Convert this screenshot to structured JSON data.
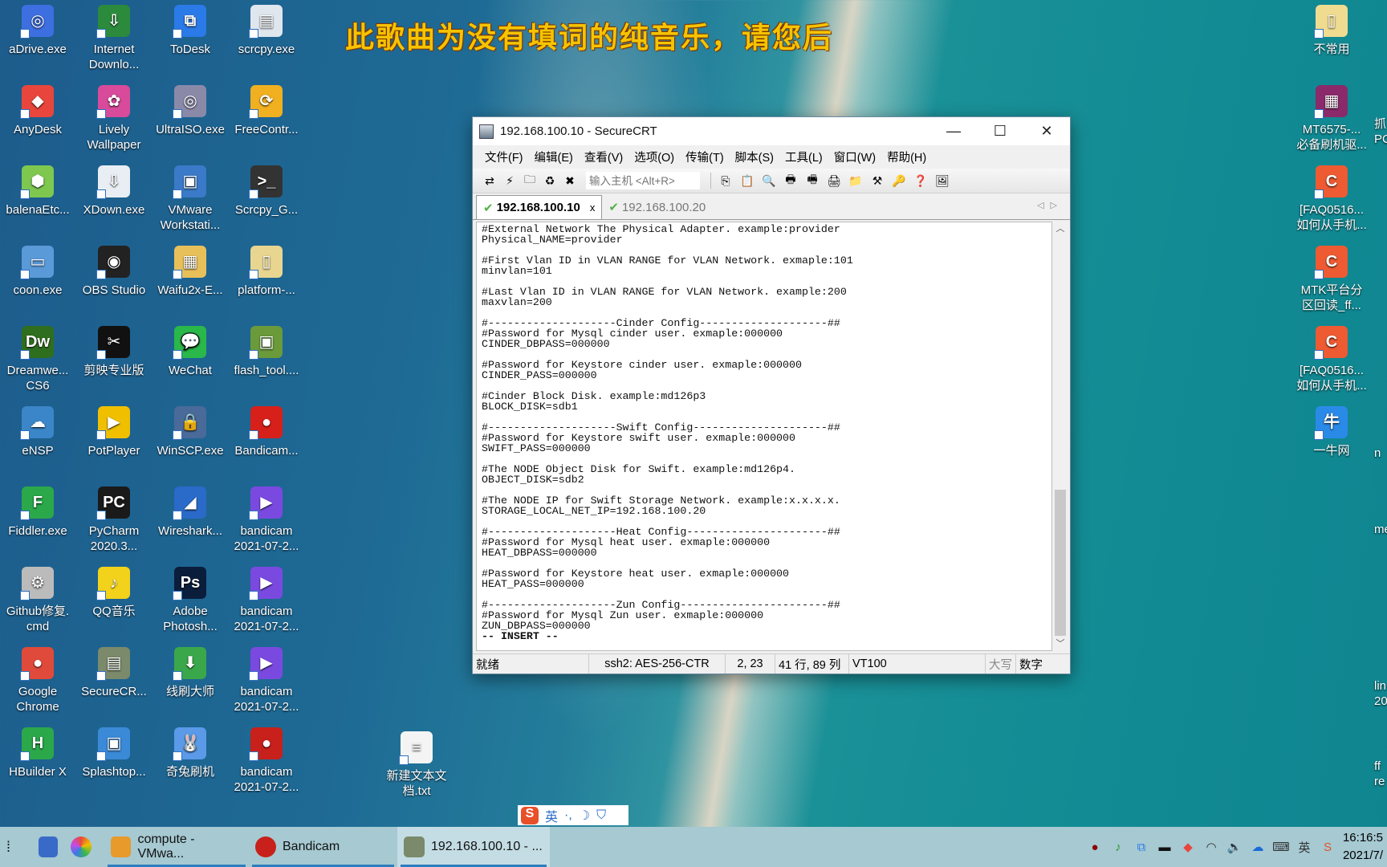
{
  "lyrics": "此歌曲为没有填词的纯音乐，请您后",
  "desktop_icons": [
    {
      "label": "aDrive.exe",
      "color": "#3d6fe0",
      "glyph": "◎"
    },
    {
      "label": "AnyDesk",
      "color": "#e8463c",
      "glyph": "◆"
    },
    {
      "label": "balenaEtc...",
      "color": "#7ec850",
      "glyph": "⬢"
    },
    {
      "label": "coon.exe",
      "color": "#5a9ad8",
      "glyph": "▭"
    },
    {
      "label": "Dreamwe...\nCS6",
      "color": "#2f6e1e",
      "glyph": "Dw"
    },
    {
      "label": "eNSP",
      "color": "#3a86c8",
      "glyph": "☁"
    },
    {
      "label": "Fiddler.exe",
      "color": "#2aa84a",
      "glyph": "F"
    },
    {
      "label": "Github修复.\ncmd",
      "color": "#bbbbbb",
      "glyph": "⚙"
    },
    {
      "label": "Google\nChrome",
      "color": "#e04a3a",
      "glyph": "●"
    },
    {
      "label": "HBuilder X",
      "color": "#2aa84a",
      "glyph": "H"
    },
    {
      "label": "Internet\nDownlo...",
      "color": "#2b8a3c",
      "glyph": "⇩"
    },
    {
      "label": "Lively\nWallpaper",
      "color": "#d84a9a",
      "glyph": "✿"
    },
    {
      "label": "XDown.exe",
      "color": "#e8eef4",
      "glyph": "⇩"
    },
    {
      "label": "OBS Studio",
      "color": "#222222",
      "glyph": "◉"
    },
    {
      "label": "剪映专业版",
      "color": "#111111",
      "glyph": "✂"
    },
    {
      "label": "PotPlayer",
      "color": "#f0c000",
      "glyph": "▶"
    },
    {
      "label": "PyCharm\n2020.3...",
      "color": "#1a1a1a",
      "glyph": "PC"
    },
    {
      "label": "QQ音乐",
      "color": "#f2d21a",
      "glyph": "♪"
    },
    {
      "label": "SecureCR...",
      "color": "#7a8a6a",
      "glyph": "▤"
    },
    {
      "label": "Splashtop...",
      "color": "#3a8ad8",
      "glyph": "▣"
    },
    {
      "label": "ToDesk",
      "color": "#2a7ae8",
      "glyph": "⧉"
    },
    {
      "label": "UltraISO.exe",
      "color": "#8a8aa8",
      "glyph": "◎"
    },
    {
      "label": "VMware\nWorkstati...",
      "color": "#3a7ac8",
      "glyph": "▣"
    },
    {
      "label": "Waifu2x-E...",
      "color": "#e8c05a",
      "glyph": "▦"
    },
    {
      "label": "WeChat",
      "color": "#2ab84a",
      "glyph": "💬"
    },
    {
      "label": "WinSCP.exe",
      "color": "#4a6a9a",
      "glyph": "🔒"
    },
    {
      "label": "Wireshark...",
      "color": "#2a6ac8",
      "glyph": "◢"
    },
    {
      "label": "Adobe\nPhotosh...",
      "color": "#0a1e3c",
      "glyph": "Ps"
    },
    {
      "label": "线刷大师",
      "color": "#3aa84a",
      "glyph": "⬇"
    },
    {
      "label": "奇兔刷机",
      "color": "#5a9ae8",
      "glyph": "🐰"
    },
    {
      "label": "scrcpy.exe",
      "color": "#dfe6ee",
      "glyph": "▤"
    },
    {
      "label": "FreeContr...",
      "color": "#f0b020",
      "glyph": "⟳"
    },
    {
      "label": "Scrcpy_G...",
      "color": "#333333",
      "glyph": ">_"
    },
    {
      "label": "platform-...",
      "color": "#e8d690",
      "glyph": "▯"
    },
    {
      "label": "flash_tool....",
      "color": "#6a9a3a",
      "glyph": "▣"
    },
    {
      "label": "Bandicam...",
      "color": "#d8201a",
      "glyph": "●"
    },
    {
      "label": "bandicam\n2021-07-2...",
      "color": "#7a4ae0",
      "glyph": "▶"
    },
    {
      "label": "bandicam\n2021-07-2...",
      "color": "#7a4ae0",
      "glyph": "▶"
    },
    {
      "label": "bandicam\n2021-07-2...",
      "color": "#7a4ae0",
      "glyph": "▶"
    },
    {
      "label": "bandicam\n2021-07-2...",
      "color": "#c8201a",
      "glyph": "●"
    },
    {
      "label": "新建文本文\n档.txt",
      "color": "#f4f4f4",
      "glyph": "≡"
    },
    {
      "label": "不常用",
      "color": "#f0dc90",
      "glyph": "▯"
    },
    {
      "label": "MT6575-...\n必备刷机驱...",
      "color": "#8a2a6a",
      "glyph": "▦"
    },
    {
      "label": "[FAQ0516...\n如何从手机...",
      "color": "#ee5a32",
      "glyph": "C"
    },
    {
      "label": "MTK平台分\n区回读_ff...",
      "color": "#ee5a32",
      "glyph": "C"
    },
    {
      "label": "[FAQ0516...\n如何从手机...",
      "color": "#ee5a32",
      "glyph": "C"
    },
    {
      "label": "一牛网",
      "color": "#2a8ae8",
      "glyph": "牛"
    }
  ],
  "edge_fragments": [
    "抓\nPC",
    "n",
    "me",
    "lin\n20",
    "ff\nre"
  ],
  "window": {
    "title": "192.168.100.10 - SecureCRT",
    "controls": {
      "minimize": "—",
      "maximize": "☐",
      "close": "✕"
    },
    "menu": [
      "文件(F)",
      "编辑(E)",
      "查看(V)",
      "选项(O)",
      "传输(T)",
      "脚本(S)",
      "工具(L)",
      "窗口(W)",
      "帮助(H)"
    ],
    "toolbar_left": [
      {
        "name": "connect-icon",
        "glyph": "⇄"
      },
      {
        "name": "quick-connect-icon",
        "glyph": "⚡"
      },
      {
        "name": "connect-tab-icon",
        "glyph": "🗀"
      },
      {
        "name": "reconnect-icon",
        "glyph": "♻"
      },
      {
        "name": "disconnect-icon",
        "glyph": "✖"
      }
    ],
    "host_placeholder": "输入主机 <Alt+R>",
    "toolbar_right": [
      {
        "name": "copy-icon",
        "glyph": "⎘"
      },
      {
        "name": "paste-icon",
        "glyph": "📋"
      },
      {
        "name": "find-icon",
        "glyph": "🔍"
      },
      {
        "name": "print-icon",
        "glyph": "🖶"
      },
      {
        "name": "print-selection-icon",
        "glyph": "🖷"
      },
      {
        "name": "print-screen-icon",
        "glyph": "🖨"
      },
      {
        "name": "session-options-icon",
        "glyph": "📁"
      },
      {
        "name": "global-options-icon",
        "glyph": "⚒"
      },
      {
        "name": "keymap-icon",
        "glyph": "🔑"
      },
      {
        "name": "help-icon",
        "glyph": "❓"
      },
      {
        "name": "sftp-icon",
        "glyph": "🖼"
      }
    ],
    "tabs": [
      {
        "label": "192.168.100.10",
        "active": true,
        "close": "x"
      },
      {
        "label": "192.168.100.20",
        "active": false
      }
    ],
    "terminal_lines": [
      "#External Network The Physical Adapter. example:provider",
      "Physical_NAME=provider",
      "",
      "#First Vlan ID in VLAN RANGE for VLAN Network. exmaple:101",
      "minvlan=101",
      "",
      "#Last Vlan ID in VLAN RANGE for VLAN Network. example:200",
      "maxvlan=200",
      "",
      "#--------------------Cinder Config--------------------##",
      "#Password for Mysql cinder user. exmaple:000000",
      "CINDER_DBPASS=000000",
      "",
      "#Password for Keystore cinder user. exmaple:000000",
      "CINDER_PASS=000000",
      "",
      "#Cinder Block Disk. example:md126p3",
      "BLOCK_DISK=sdb1",
      "",
      "#--------------------Swift Config---------------------##",
      "#Password for Keystore swift user. exmaple:000000",
      "SWIFT_PASS=000000",
      "",
      "#The NODE Object Disk for Swift. example:md126p4.",
      "OBJECT_DISK=sdb2",
      "",
      "#The NODE IP for Swift Storage Network. example:x.x.x.x.",
      "STORAGE_LOCAL_NET_IP=192.168.100.20",
      "",
      "#--------------------Heat Config----------------------##",
      "#Password for Mysql heat user. exmaple:000000",
      "HEAT_DBPASS=000000",
      "",
      "#Password for Keystore heat user. exmaple:000000",
      "HEAT_PASS=000000",
      "",
      "#--------------------Zun Config-----------------------##",
      "#Password for Mysql Zun user. exmaple:000000",
      "ZUN_DBPASS=000000",
      ""
    ],
    "mode_line": "-- INSERT --",
    "status": {
      "ready": "就绪",
      "cipher": "ssh2: AES-256-CTR",
      "cursor": "2,  23",
      "size": "41 行, 89 列",
      "emulation": "VT100",
      "caps": "大写",
      "num": "数字"
    }
  },
  "taskbar": {
    "apps": [
      {
        "label": "compute - VMwa...",
        "color": "#e89a2a"
      },
      {
        "label": "Bandicam",
        "color": "#c8201a"
      },
      {
        "label": "192.168.100.10 - ...",
        "color": "#7a8a6a",
        "active": true
      }
    ],
    "tray": [
      {
        "name": "bandicam-tray-icon",
        "glyph": "●",
        "color": "#8a0000"
      },
      {
        "name": "qqmusic-tray-icon",
        "glyph": "♪",
        "color": "#2a9a2a"
      },
      {
        "name": "todesk-tray-icon",
        "glyph": "⧉",
        "color": "#2a7ae8"
      },
      {
        "name": "battery-icon",
        "glyph": "▬",
        "color": "#111"
      },
      {
        "name": "anydesk-tray-icon",
        "glyph": "◆",
        "color": "#e8463c"
      },
      {
        "name": "wifi-icon",
        "glyph": "◠",
        "color": "#333"
      },
      {
        "name": "volume-icon",
        "glyph": "🔈",
        "color": "#333"
      },
      {
        "name": "onedrive-icon",
        "glyph": "☁",
        "color": "#1a6ad8"
      },
      {
        "name": "keyboard-icon",
        "glyph": "⌨",
        "color": "#333"
      },
      {
        "name": "ime-lang-icon",
        "glyph": "英",
        "color": "#333"
      },
      {
        "name": "sogou-tray-icon",
        "glyph": "S",
        "color": "#e8502a"
      }
    ],
    "time": "16:16:5",
    "date": "2021/7/"
  },
  "ime_bar": {
    "logo": "S",
    "items": [
      "英",
      "·,",
      "☽",
      "⛉"
    ]
  }
}
